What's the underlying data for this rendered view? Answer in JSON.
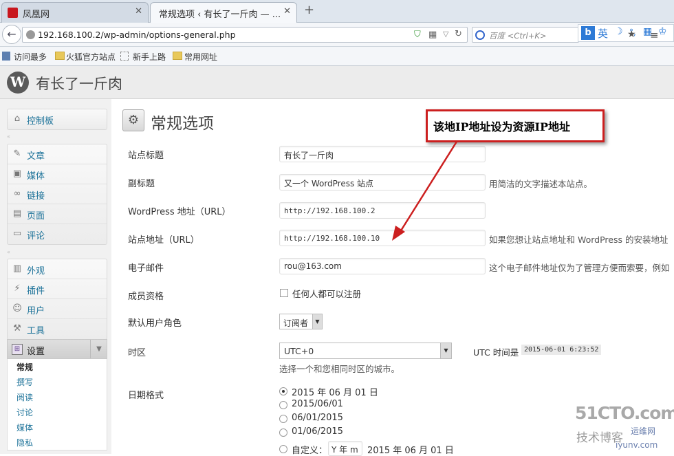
{
  "browser": {
    "tabs": [
      {
        "title": "凤凰网"
      },
      {
        "title": "常规选项 ‹ 有长了一斤肉 — ..."
      }
    ],
    "new_tab": "+",
    "url": "192.168.100.2/wp-admin/options-general.php",
    "search_placeholder": "百度 <Ctrl+K>",
    "ime_label": "英"
  },
  "bookmarks": [
    "访问最多",
    "火狐官方站点",
    "新手上路",
    "常用网址"
  ],
  "wp": {
    "site_title": "有长了一斤肉"
  },
  "sidebar": {
    "dashboard": "控制板",
    "group1": [
      "文章",
      "媒体",
      "链接",
      "页面",
      "评论"
    ],
    "group2": [
      "外观",
      "插件",
      "用户",
      "工具"
    ],
    "settings": "设置",
    "submenu": [
      "常规",
      "撰写",
      "阅读",
      "讨论",
      "媒体",
      "隐私"
    ]
  },
  "page": {
    "heading": "常规选项",
    "fields": {
      "blogname_label": "站点标题",
      "blogname_value": "有长了一斤肉",
      "tagline_label": "副标题",
      "tagline_value": "又一个 WordPress 站点",
      "tagline_desc": "用简洁的文字描述本站点。",
      "wpurl_label": "WordPress 地址（URL）",
      "wpurl_value": "http://192.168.100.2",
      "siteurl_label": "站点地址（URL）",
      "siteurl_value": "http://192.168.100.10",
      "siteurl_desc": "如果您想让站点地址和 WordPress 的安装地址",
      "email_label": "电子邮件",
      "email_value": "rou@163.com",
      "email_desc": "这个电子邮件地址仅为了管理方便而索要，例如",
      "membership_label": "成员资格",
      "membership_checkbox": "任何人都可以注册",
      "role_label": "默认用户角色",
      "role_value": "订阅者",
      "timezone_label": "时区",
      "timezone_value": "UTC+0",
      "utc_time_label": "UTC 时间是",
      "utc_time_value": "2015-06-01 6:23:52",
      "timezone_desc": "选择一个和您相同时区的城市。",
      "date_format_label": "日期格式",
      "date_formats": [
        "2015 年 06 月 01 日",
        "2015/06/01",
        "06/01/2015",
        "01/06/2015"
      ],
      "custom_label": "自定义：",
      "custom_value": "Y 年 m",
      "custom_preview": "2015 年 06 月 01 日"
    }
  },
  "annotation": {
    "text": "该地IP地址设为资源IP地址",
    "color": "#cc1f1f"
  },
  "watermark": {
    "brand": "51CTO.com",
    "line2": "技术博客",
    "line3": "运维网",
    "line4": "iyunv.com"
  }
}
